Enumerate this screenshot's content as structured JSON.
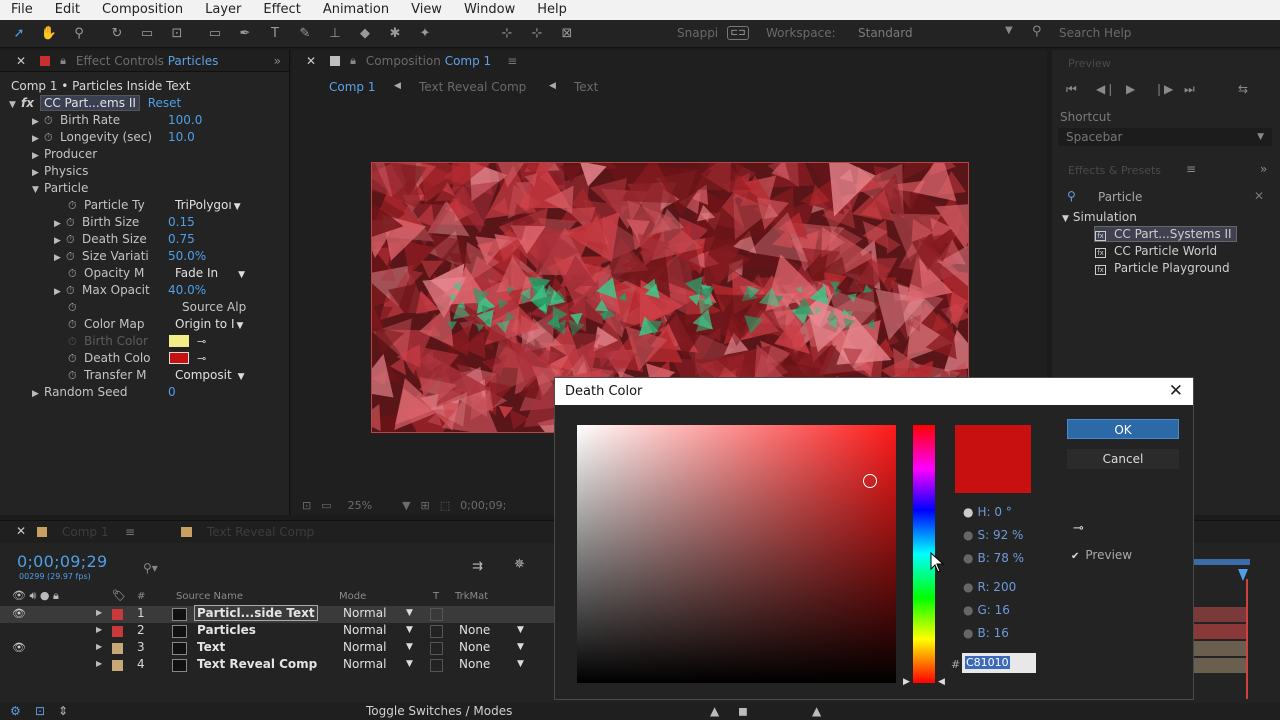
{
  "menu": [
    "File",
    "Edit",
    "Composition",
    "Layer",
    "Effect",
    "Animation",
    "View",
    "Window",
    "Help"
  ],
  "toolbar": {
    "snapping_label": "Snappi",
    "workspace_label": "Workspace:",
    "workspace_value": "Standard",
    "search_placeholder": "Search Help"
  },
  "effect_controls": {
    "tab_prefix": "Effect Controls",
    "tab_layer": "Particles",
    "header": "Comp 1 • Particles Inside Text",
    "effect_name": "CC Part...ems II",
    "reset_label": "Reset",
    "props": {
      "birth_rate": {
        "label": "Birth Rate",
        "value": "100.0"
      },
      "longevity": {
        "label": "Longevity (sec)",
        "value": "10.0"
      },
      "producer": {
        "label": "Producer"
      },
      "physics": {
        "label": "Physics"
      },
      "particle": {
        "label": "Particle"
      },
      "particle_type": {
        "label": "Particle Ty",
        "value": "TriPolygoı"
      },
      "birth_size": {
        "label": "Birth Size",
        "value": "0.15"
      },
      "death_size": {
        "label": "Death Size",
        "value": "0.75"
      },
      "size_variation": {
        "label": "Size Variati",
        "value": "50.0%"
      },
      "opacity_map": {
        "label": "Opacity M",
        "value": "Fade In"
      },
      "max_opacity": {
        "label": "Max Opacit",
        "value": "40.0%"
      },
      "source_alpha": {
        "label": "Source Alp"
      },
      "color_map": {
        "label": "Color Map",
        "value": "Origin to I"
      },
      "birth_color": {
        "label": "Birth Color",
        "color": "#f2ee8a"
      },
      "death_color": {
        "label": "Death Colo",
        "color": "#c81010"
      },
      "transfer_mode": {
        "label": "Transfer M",
        "value": "Composit"
      },
      "random_seed": {
        "label": "Random Seed",
        "value": "0"
      }
    }
  },
  "composition": {
    "tab_prefix": "Composition",
    "tab_name": "Comp 1",
    "crumbs": [
      "Comp 1",
      "Text Reveal Comp",
      "Text"
    ],
    "zoom": "25%",
    "timecode": "0;00;09;"
  },
  "right_panels": {
    "preview_title": "Preview",
    "shortcut_label": "Shortcut",
    "shortcut_value": "Spacebar",
    "effects_title": "Effects & Presets",
    "search_value": "Particle",
    "category": "Simulation",
    "items": [
      "CC Part...Systems II",
      "CC Particle World",
      "Particle Playground"
    ]
  },
  "timeline": {
    "tab1": "Comp 1",
    "tab2": "Text Reveal Comp",
    "timecode": "0;00;09;29",
    "frame_fps": "00299 (29.97 fps)",
    "col_source": "Source Name",
    "col_mode": "Mode",
    "col_t": "T",
    "col_trkmat": "TrkMat",
    "col_num": "#",
    "layers": [
      {
        "num": "1",
        "name": "Particl...side Text",
        "mode": "Normal",
        "trkmat": "",
        "label_color": "#c83a3a"
      },
      {
        "num": "2",
        "name": "Particles",
        "mode": "Normal",
        "trkmat": "None",
        "label_color": "#c83a3a"
      },
      {
        "num": "3",
        "name": "Text",
        "mode": "Normal",
        "trkmat": "None",
        "label_color": "#c8a878"
      },
      {
        "num": "4",
        "name": "Text Reveal Comp",
        "mode": "Normal",
        "trkmat": "None",
        "label_color": "#c8a878"
      }
    ],
    "toggle_label": "Toggle Switches / Modes"
  },
  "dialog": {
    "title": "Death Color",
    "ok_label": "OK",
    "cancel_label": "Cancel",
    "preview_label": "Preview",
    "selected_color": "#c81010",
    "H": "H: 0 °",
    "S": "S: 92 %",
    "B": "B: 78 %",
    "R": "R: 200",
    "G": "G: 16",
    "Bl": "B: 16",
    "hex": "C81010"
  }
}
